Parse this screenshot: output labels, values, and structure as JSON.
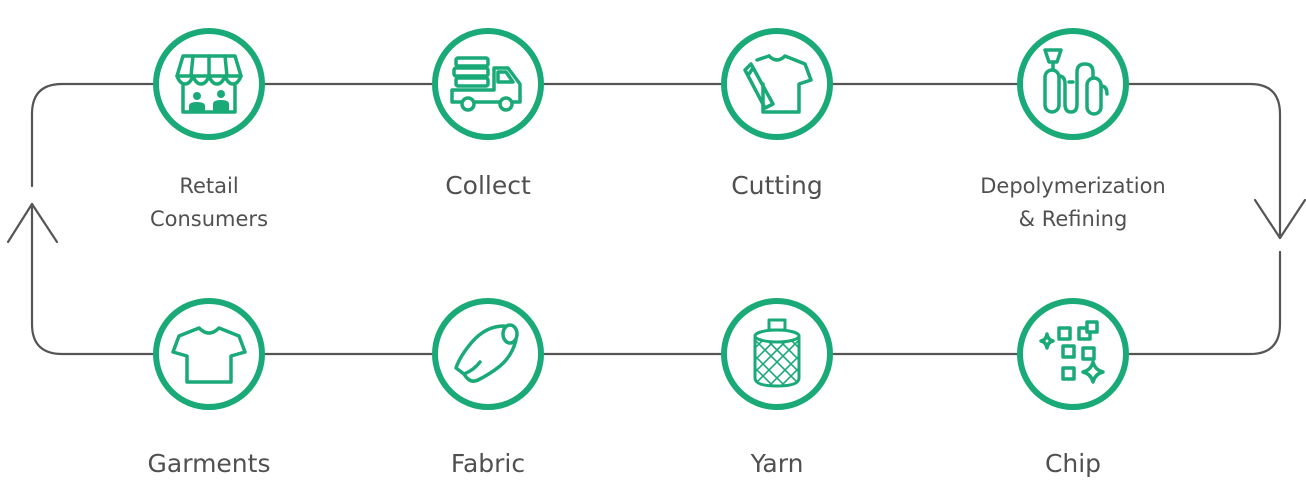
{
  "colors": {
    "accent": "#1aaa78",
    "line": "#555555",
    "text": "#505050"
  },
  "flow_direction": "clockwise",
  "steps": [
    {
      "id": "retail-consumers",
      "label_lines": [
        "Retail",
        "Consumers"
      ],
      "icon": "storefront-icon"
    },
    {
      "id": "collect",
      "label_lines": [
        "Collect"
      ],
      "icon": "delivery-truck-icon"
    },
    {
      "id": "cutting",
      "label_lines": [
        "Cutting"
      ],
      "icon": "shirt-cutting-icon"
    },
    {
      "id": "depolymerization",
      "label_lines": [
        "Depolymerization",
        "& Refining"
      ],
      "icon": "refinery-icon"
    },
    {
      "id": "chip",
      "label_lines": [
        "Chip"
      ],
      "icon": "chips-sparkle-icon"
    },
    {
      "id": "yarn",
      "label_lines": [
        "Yarn"
      ],
      "icon": "yarn-spool-icon"
    },
    {
      "id": "fabric",
      "label_lines": [
        "Fabric"
      ],
      "icon": "fabric-roll-icon"
    },
    {
      "id": "garments",
      "label_lines": [
        "Garments"
      ],
      "icon": "tshirt-icon"
    }
  ]
}
